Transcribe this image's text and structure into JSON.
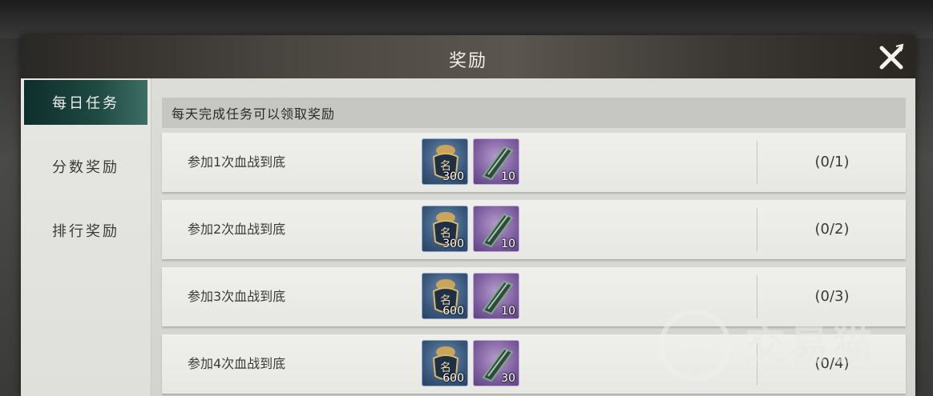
{
  "window": {
    "title": "奖励"
  },
  "sidebar": {
    "tabs": [
      {
        "label": "每日任务",
        "active": true
      },
      {
        "label": "分数奖励",
        "active": false
      },
      {
        "label": "排行奖励",
        "active": false
      }
    ]
  },
  "main": {
    "header": "每天完成任务可以领取奖励",
    "rows": [
      {
        "label": "参加1次血战到底",
        "rewards": [
          {
            "icon": "name-pouch-icon",
            "qty": "300",
            "rarity": "blue"
          },
          {
            "icon": "jade-scroll-icon",
            "qty": "10",
            "rarity": "purple"
          }
        ],
        "progress": "(0/1)"
      },
      {
        "label": "参加2次血战到底",
        "rewards": [
          {
            "icon": "name-pouch-icon",
            "qty": "300",
            "rarity": "blue"
          },
          {
            "icon": "jade-scroll-icon",
            "qty": "10",
            "rarity": "purple"
          }
        ],
        "progress": "(0/2)"
      },
      {
        "label": "参加3次血战到底",
        "rewards": [
          {
            "icon": "name-pouch-icon",
            "qty": "600",
            "rarity": "blue"
          },
          {
            "icon": "jade-scroll-icon",
            "qty": "10",
            "rarity": "purple"
          }
        ],
        "progress": "(0/3)"
      },
      {
        "label": "参加4次血战到底",
        "rewards": [
          {
            "icon": "name-pouch-icon",
            "qty": "600",
            "rarity": "blue"
          },
          {
            "icon": "jade-scroll-icon",
            "qty": "30",
            "rarity": "purple"
          }
        ],
        "progress": "(0/4)"
      }
    ]
  },
  "watermark": {
    "text": "交易猫"
  },
  "colors": {
    "active_tab": "#1f4a44",
    "blue_item": "#3b5a7d",
    "purple_item": "#7e5fa0"
  }
}
